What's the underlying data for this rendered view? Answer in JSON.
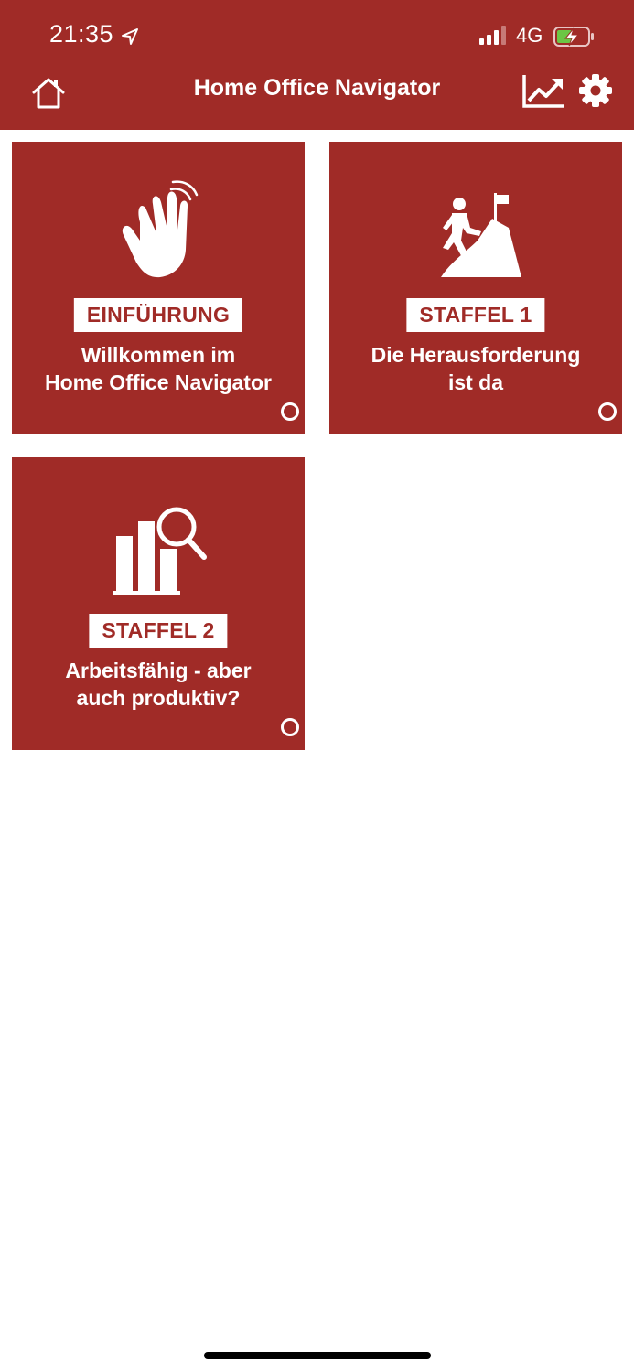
{
  "status_bar": {
    "time": "21:35",
    "network": "4G",
    "icons": [
      "location-arrow-icon",
      "signal-bars-icon",
      "battery-charging-icon"
    ]
  },
  "nav": {
    "title": "Home Office Navigator",
    "icons": [
      "home-icon",
      "trend-chart-icon",
      "gear-icon"
    ]
  },
  "colors": {
    "brand": "#a02b27",
    "background": "#ffffff",
    "text_on_brand": "#ffffff",
    "battery_charge": "#6cc644"
  },
  "tiles": [
    {
      "badge": "EINFÜHRUNG",
      "title_line1": "Willkommen im",
      "title_line2": "Home Office Navigator",
      "icon": "waving-hand-icon"
    },
    {
      "badge": "STAFFEL 1",
      "title_line1": "Die Herausforderung",
      "title_line2": "ist da",
      "icon": "mountain-climber-icon"
    },
    {
      "badge": "STAFFEL 2",
      "title_line1": "Arbeitsfähig - aber",
      "title_line2": "auch produktiv?",
      "icon": "bar-chart-search-icon"
    }
  ]
}
